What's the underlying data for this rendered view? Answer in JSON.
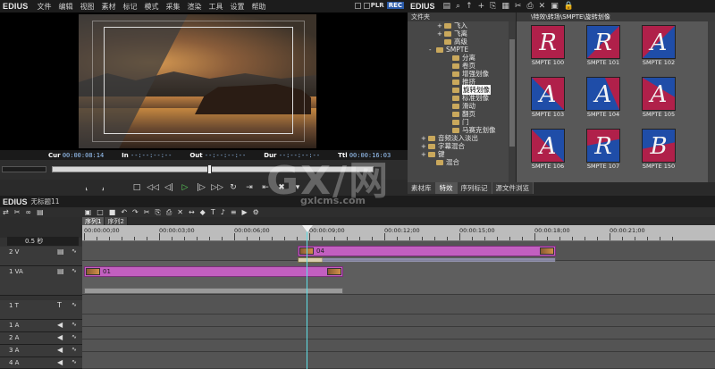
{
  "player": {
    "app_logo": "EDIUS",
    "menu": [
      "文件",
      "编辑",
      "视图",
      "素材",
      "标记",
      "模式",
      "采集",
      "渲染",
      "工具",
      "设置",
      "帮助"
    ],
    "plr": "PLR",
    "rec": "REC",
    "timecode": [
      {
        "label": "Cur",
        "value": "00:00:08:14"
      },
      {
        "label": "In",
        "value": "--:--:--:--"
      },
      {
        "label": "Out",
        "value": "--:--:--:--"
      },
      {
        "label": "Dur",
        "value": "--:--:--:--"
      },
      {
        "label": "Ttl",
        "value": "00:00:16:03"
      }
    ],
    "transport_icons": [
      "in-point-icon",
      "out-point-icon",
      "stop-icon",
      "rewind-icon",
      "step-back-icon",
      "play-icon",
      "step-forward-icon",
      "fast-forward-icon",
      "loop-icon",
      "insert-icon",
      "overwrite-icon",
      "delete-icon",
      "menu-icon"
    ]
  },
  "bin": {
    "app_logo": "EDIUS",
    "folder_header": "文件夹",
    "folders": [
      {
        "label": "飞入",
        "indent": 3,
        "prefix": "+"
      },
      {
        "label": "飞离",
        "indent": 3,
        "prefix": "+"
      },
      {
        "label": "高级",
        "indent": 3,
        "prefix": ""
      },
      {
        "label": "SMPTE",
        "indent": 2,
        "prefix": "-"
      },
      {
        "label": "分离",
        "indent": 4,
        "prefix": ""
      },
      {
        "label": "卷页",
        "indent": 4,
        "prefix": ""
      },
      {
        "label": "增强划像",
        "indent": 4,
        "prefix": ""
      },
      {
        "label": "推挤",
        "indent": 4,
        "prefix": ""
      },
      {
        "label": "旋转划像",
        "indent": 4,
        "prefix": "",
        "selected": true
      },
      {
        "label": "标准划像",
        "indent": 4,
        "prefix": ""
      },
      {
        "label": "滑动",
        "indent": 4,
        "prefix": ""
      },
      {
        "label": "翻页",
        "indent": 4,
        "prefix": ""
      },
      {
        "label": "门",
        "indent": 4,
        "prefix": ""
      },
      {
        "label": "马赛克划像",
        "indent": 4,
        "prefix": ""
      },
      {
        "label": "音频淡入淡出",
        "indent": 1,
        "prefix": "+"
      },
      {
        "label": "字幕混合",
        "indent": 1,
        "prefix": "+"
      },
      {
        "label": "键",
        "indent": 1,
        "prefix": "+"
      },
      {
        "label": "混合",
        "indent": 2,
        "prefix": ""
      }
    ],
    "path": "\\特效\\转场\\SMPTE\\旋转划像",
    "clips": [
      {
        "caption": "SMPTE 100",
        "glyph": "R"
      },
      {
        "caption": "SMPTE 101",
        "glyph": "R"
      },
      {
        "caption": "SMPTE 102",
        "glyph": "A"
      },
      {
        "caption": "SMPTE 103",
        "glyph": "A"
      },
      {
        "caption": "SMPTE 104",
        "glyph": "A"
      },
      {
        "caption": "SMPTE 105",
        "glyph": "A"
      },
      {
        "caption": "SMPTE 106",
        "glyph": "A"
      },
      {
        "caption": "SMPTE 107",
        "glyph": "R"
      },
      {
        "caption": "SMPTE 150",
        "glyph": "B"
      }
    ],
    "tabs": [
      {
        "label": "素材库",
        "active": false
      },
      {
        "label": "特效",
        "active": true
      },
      {
        "label": "序列标记",
        "active": false
      },
      {
        "label": "源文件浏览",
        "active": false
      }
    ]
  },
  "timeline": {
    "app_logo": "EDIUS",
    "project": "无标题11",
    "seq_tabs": [
      {
        "label": "序列1",
        "active": true
      },
      {
        "label": "序列2",
        "active": false
      }
    ],
    "zoom": "0.5 秒",
    "ruler": [
      "00:00:00;00",
      "00:00:03;00",
      "00:00:06;00",
      "00:00:09;00",
      "00:00:12;00",
      "00:00:15;00",
      "00:00:18;00",
      "00:00:21;00"
    ],
    "tracks": [
      {
        "name": "2 V"
      },
      {
        "name": "1 VA"
      },
      {
        "name": "1 T"
      },
      {
        "name": "1 A"
      },
      {
        "name": "2 A"
      },
      {
        "name": "3 A"
      },
      {
        "name": "4 A"
      }
    ],
    "clip_v2": "04",
    "clip_v1": "01"
  },
  "watermark": {
    "big": "GX/网",
    "small": "gxlcms.com"
  }
}
